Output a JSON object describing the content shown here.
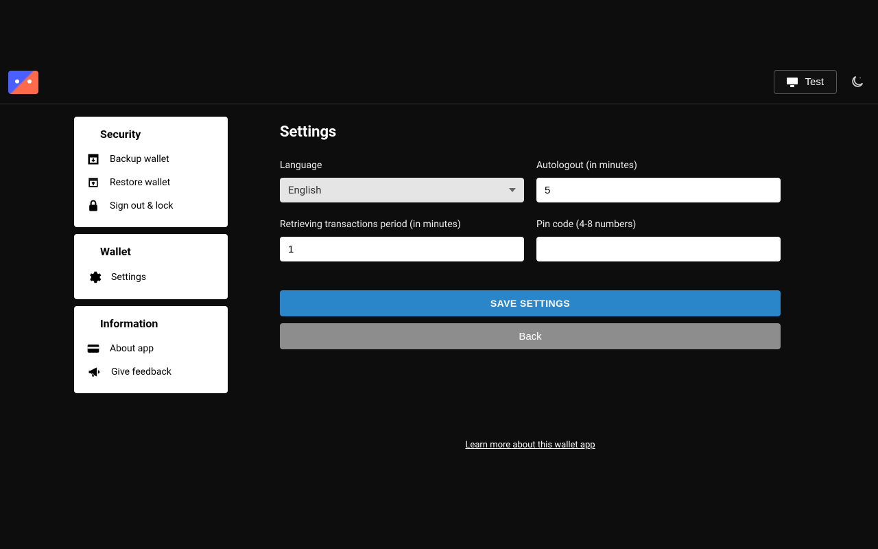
{
  "header": {
    "test_label": "Test"
  },
  "sidebar": {
    "security": {
      "title": "Security",
      "items": [
        {
          "label": "Backup wallet"
        },
        {
          "label": "Restore wallet"
        },
        {
          "label": "Sign out & lock"
        }
      ]
    },
    "wallet": {
      "title": "Wallet",
      "items": [
        {
          "label": "Settings"
        }
      ]
    },
    "information": {
      "title": "Information",
      "items": [
        {
          "label": "About app"
        },
        {
          "label": "Give feedback"
        }
      ]
    }
  },
  "main": {
    "title": "Settings",
    "fields": {
      "language": {
        "label": "Language",
        "value": "English"
      },
      "autologout": {
        "label": "Autologout (in minutes)",
        "value": "5"
      },
      "retrieving": {
        "label": "Retrieving transactions period (in minutes)",
        "value": "1"
      },
      "pin": {
        "label": "Pin code (4-8 numbers)",
        "value": ""
      }
    },
    "buttons": {
      "save": "Save Settings",
      "back": "Back"
    },
    "learn_link": "Learn more about this wallet app"
  }
}
